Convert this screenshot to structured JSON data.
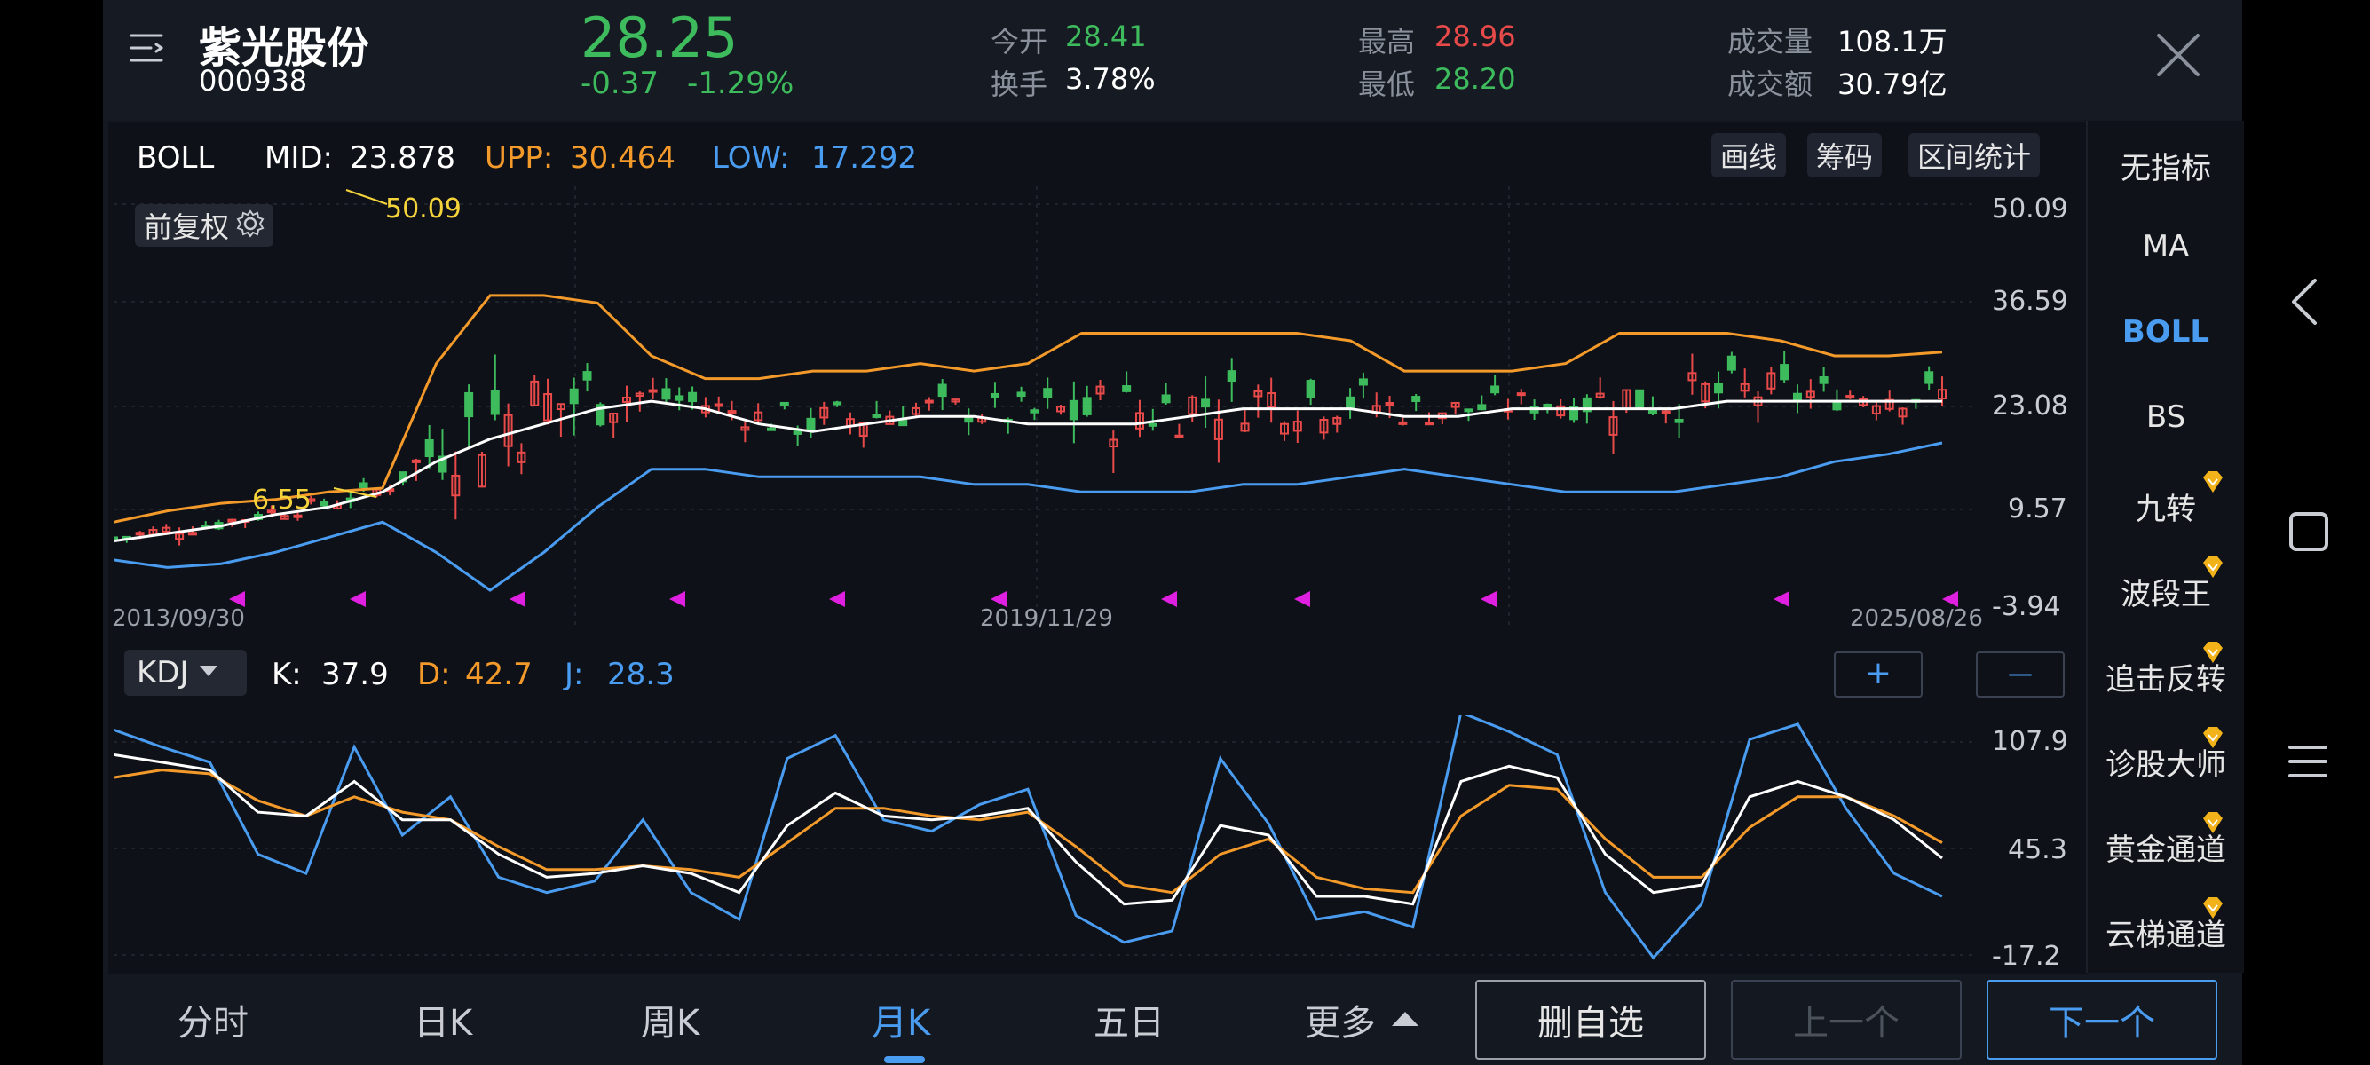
{
  "stock": {
    "name": "紫光股份",
    "code": "000938",
    "price": "28.25",
    "change": "-0.37",
    "change_pct": "-1.29%"
  },
  "quote": {
    "open_label": "今开",
    "open": "28.41",
    "turnover_label": "换手",
    "turnover": "3.78%",
    "high_label": "最高",
    "high": "28.96",
    "low_label": "最低",
    "low": "28.20",
    "volume_label": "成交量",
    "volume": "108.1万",
    "amount_label": "成交额",
    "amount": "30.79亿"
  },
  "boll": {
    "name": "BOLL",
    "mid_label": "MID:",
    "mid": "23.878",
    "upp_label": "UPP:",
    "upp": "30.464",
    "low_label": "LOW:",
    "low": "17.292"
  },
  "tools": {
    "draw": "画线",
    "chips": "筹码",
    "range": "区间统计"
  },
  "adjust": {
    "label": "前复权"
  },
  "price_axis": [
    "50.09",
    "36.59",
    "23.08",
    "9.57",
    "-3.94"
  ],
  "annotations": {
    "max": "50.09",
    "min": "6.55"
  },
  "dates": [
    "2013/09/30",
    "2019/11/29",
    "2025/08/26"
  ],
  "kdj": {
    "name": "KDJ",
    "k_label": "K:",
    "k": "37.9",
    "d_label": "D:",
    "d": "42.7",
    "j_label": "J:",
    "j": "28.3",
    "axis": [
      "107.9",
      "45.3",
      "-17.2"
    ],
    "plus": "+",
    "minus": "—"
  },
  "sidebar": [
    "无指标",
    "MA",
    "BOLL",
    "BS",
    "九转",
    "波段王",
    "追击反转",
    "诊股大师",
    "黄金通道",
    "云梯通道"
  ],
  "tabs": [
    "分时",
    "日K",
    "周K",
    "月K",
    "五日",
    "更多"
  ],
  "buttons": {
    "remove": "删自选",
    "prev": "上一个",
    "next": "下一个"
  },
  "colors": {
    "up": "#e84a4a",
    "down": "#3dbb5d",
    "mid": "#ffffff",
    "upp": "#f39a2b",
    "low": "#4a9cf0",
    "accent": "#4a9cf0"
  },
  "chart_data": [
    {
      "type": "line",
      "title": "BOLL",
      "x_dates": [
        "2013/09/30",
        "2019/11/29",
        "2025/08/26"
      ],
      "ylim": [
        -3.94,
        50.09
      ],
      "series": [
        {
          "name": "MID",
          "values": [
            5.5,
            6.5,
            7.5,
            9,
            10,
            12,
            16,
            19,
            21,
            23,
            24,
            23,
            21,
            20,
            21,
            22,
            22,
            21,
            21,
            21,
            22,
            23,
            23,
            23,
            22,
            22,
            23,
            23,
            23,
            23,
            24,
            24,
            24,
            24,
            24
          ]
        },
        {
          "name": "UPP",
          "values": [
            8,
            9.5,
            10.5,
            11,
            12,
            12.5,
            29,
            38,
            38,
            37,
            30,
            27,
            27,
            28,
            28,
            29,
            28,
            29,
            33,
            33,
            33,
            33,
            33,
            32,
            28,
            28,
            28,
            29,
            33,
            33,
            33,
            32,
            30,
            30,
            30.5
          ]
        },
        {
          "name": "LOW",
          "values": [
            3,
            2,
            2.5,
            4,
            6,
            8,
            4,
            -1,
            4,
            10,
            15,
            15,
            14,
            14,
            14,
            14,
            13,
            13,
            12,
            12,
            12,
            13,
            13,
            14,
            15,
            14,
            13,
            12,
            12,
            12,
            13,
            14,
            16,
            17,
            18.5
          ]
        }
      ]
    },
    {
      "type": "line",
      "title": "KDJ",
      "ylim": [
        -17.2,
        107.9
      ],
      "series": [
        {
          "name": "K",
          "values": [
            92,
            88,
            84,
            62,
            60,
            78,
            58,
            58,
            40,
            28,
            30,
            34,
            30,
            20,
            55,
            72,
            60,
            58,
            60,
            64,
            36,
            14,
            16,
            55,
            50,
            18,
            18,
            14,
            78,
            86,
            80,
            40,
            20,
            24,
            70,
            78,
            70,
            58,
            38
          ]
        },
        {
          "name": "D",
          "values": [
            80,
            84,
            82,
            68,
            60,
            70,
            62,
            58,
            44,
            32,
            32,
            34,
            32,
            28,
            46,
            64,
            64,
            60,
            58,
            62,
            44,
            24,
            20,
            40,
            48,
            28,
            22,
            20,
            60,
            76,
            74,
            48,
            28,
            28,
            54,
            70,
            70,
            60,
            46
          ]
        },
        {
          "name": "J",
          "values": [
            105,
            96,
            88,
            40,
            30,
            96,
            50,
            70,
            28,
            20,
            26,
            58,
            20,
            6,
            90,
            102,
            58,
            52,
            66,
            74,
            8,
            -6,
            0,
            90,
            56,
            6,
            10,
            2,
            114,
            104,
            92,
            20,
            -14,
            14,
            100,
            108,
            64,
            30,
            18
          ]
        }
      ]
    }
  ]
}
